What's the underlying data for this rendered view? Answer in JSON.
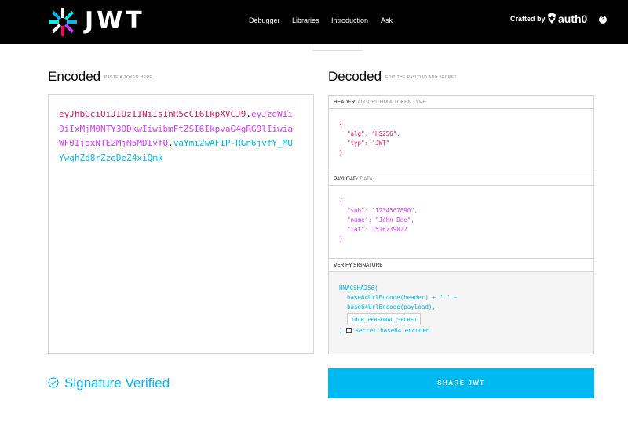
{
  "brand": {
    "logo_text": "JWT",
    "crafted_by": "Crafted by",
    "auth0": "auth0"
  },
  "nav": {
    "items": [
      "Debugger",
      "Libraries",
      "Introduction",
      "Ask"
    ]
  },
  "encoded": {
    "title": "Encoded",
    "subtitle": "PASTE A TOKEN HERE",
    "token_header": "eyJhbGciOiJIUzI1NiIsInR5cCI6IkpXVCJ9",
    "token_payload": "eyJzdWIiOiIxMjM0NTY3ODkwIiwibmFtZSI6IkpvaG4gRG9lIiwiaWF0IjoxNTE2MjM5MDIyfQ",
    "token_signature": "vaYmi2wAFIP-RGn6jvfY_MUYwghZd8rZzeDeZ4xiQmk"
  },
  "decoded": {
    "title": "Decoded",
    "subtitle": "EDIT THE PAYLOAD AND SECRET",
    "header_label": "HEADER:",
    "header_sub": "ALGORITHM & TOKEN TYPE",
    "header_json": [
      "{",
      "\"alg\": \"HS256\",",
      "\"typ\": \"JWT\"",
      "}"
    ],
    "payload_label": "PAYLOAD:",
    "payload_sub": "DATA",
    "payload_json": [
      "{",
      "\"sub\": \"1234567890\",",
      "\"name\": \"John Doe\",",
      "\"iat\": 1516239022",
      "}"
    ],
    "verify_label": "VERIFY SIGNATURE",
    "verify_lines": [
      "HMACSHA256(",
      "base64UrlEncode(header) + \".\" +",
      "base64UrlEncode(payload),"
    ],
    "secret_placeholder": "YOUR_PERSONAL_SECRET",
    "close_paren": ")",
    "checkbox_label": "secret base64 encoded"
  },
  "status": {
    "verified_text": "Signature Verified"
  },
  "share_button": "SHARE JWT",
  "colors": {
    "header": "#e0115f",
    "payload": "#d63aff",
    "signature": "#00b9f1",
    "accent": "#00b9f1"
  }
}
